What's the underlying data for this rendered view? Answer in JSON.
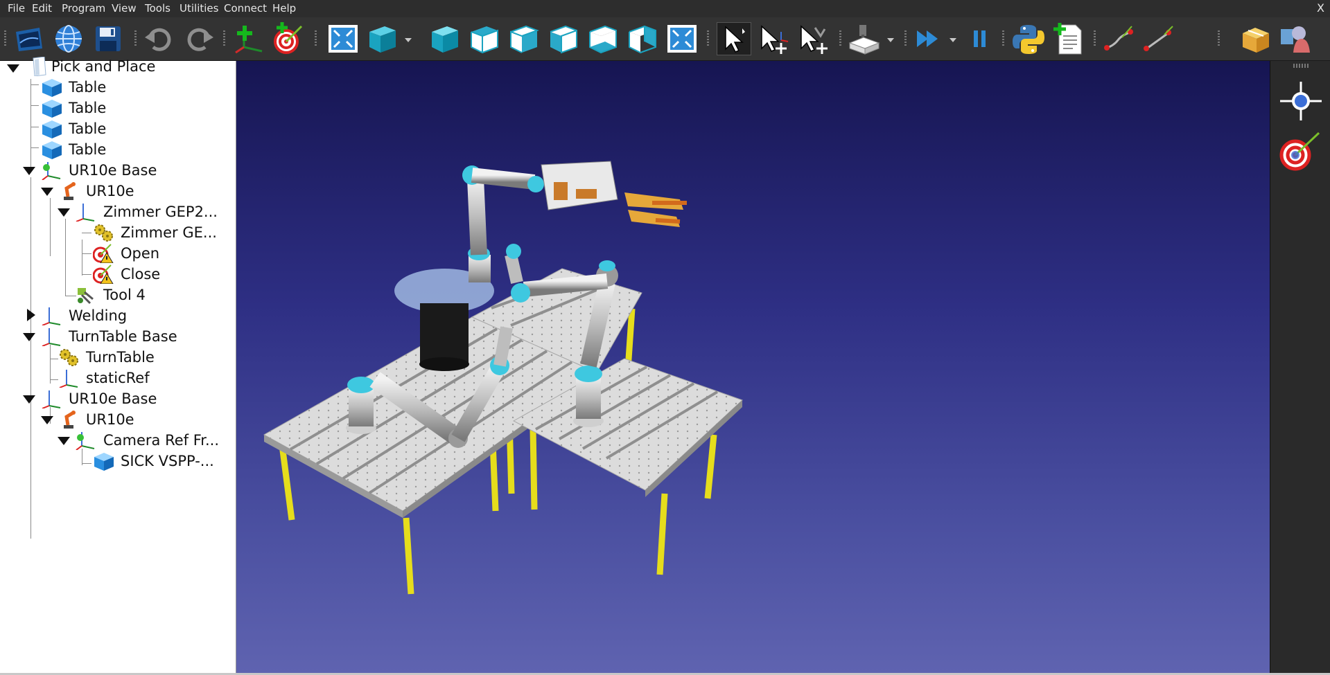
{
  "menubar": {
    "items": [
      "File",
      "Edit",
      "Program",
      "View",
      "Tools",
      "Utilities",
      "Connect",
      "Help"
    ],
    "close_label": "X"
  },
  "toolbar": {
    "buttons": [
      {
        "name": "open-station-icon",
        "active": false
      },
      {
        "name": "open-online-library-icon",
        "active": false
      },
      {
        "name": "save-icon",
        "active": false
      },
      {
        "name": "undo-icon",
        "active": false
      },
      {
        "name": "redo-icon",
        "active": false
      },
      {
        "name": "add-reference-frame-icon",
        "active": false
      },
      {
        "name": "add-target-icon",
        "active": false
      },
      {
        "name": "fit-all-icon",
        "active": false
      },
      {
        "name": "view-iso-icon",
        "active": false
      },
      {
        "name": "view-front-icon",
        "active": false
      },
      {
        "name": "view-top-icon",
        "active": false
      },
      {
        "name": "view-right-icon",
        "active": false
      },
      {
        "name": "view-left-icon",
        "active": false
      },
      {
        "name": "view-back-icon",
        "active": false
      },
      {
        "name": "view-bottom-icon",
        "active": false
      },
      {
        "name": "fit-selection-icon",
        "active": false
      },
      {
        "name": "select-pointer-icon",
        "active": true
      },
      {
        "name": "move-reference-icon",
        "active": false
      },
      {
        "name": "move-tool-icon",
        "active": false
      },
      {
        "name": "collision-check-icon",
        "active": false
      },
      {
        "name": "fast-simulation-icon",
        "active": false
      },
      {
        "name": "pause-icon",
        "active": false
      },
      {
        "name": "python-script-icon",
        "active": false
      },
      {
        "name": "add-program-icon",
        "active": false
      },
      {
        "name": "add-move-joint-icon",
        "active": false
      },
      {
        "name": "add-move-linear-icon",
        "active": false
      },
      {
        "name": "add-object-icon",
        "active": false
      },
      {
        "name": "3d-shapes-icon",
        "active": false
      }
    ]
  },
  "tree": {
    "items": [
      {
        "label": "Pick and Place",
        "icon": "station-icon",
        "expander": "open"
      },
      {
        "label": "Table",
        "icon": "object-icon",
        "expander": "none"
      },
      {
        "label": "Table",
        "icon": "object-icon",
        "expander": "none"
      },
      {
        "label": "Table",
        "icon": "object-icon",
        "expander": "none"
      },
      {
        "label": "Table",
        "icon": "object-icon",
        "expander": "none"
      },
      {
        "label": "UR10e Base",
        "icon": "base-frame-icon",
        "expander": "open"
      },
      {
        "label": "UR10e",
        "icon": "robot-icon",
        "expander": "open"
      },
      {
        "label": "Zimmer GEP2...",
        "icon": "reference-frame-icon",
        "expander": "open"
      },
      {
        "label": "Zimmer GE...",
        "icon": "mechanism-icon",
        "expander": "none"
      },
      {
        "label": "Open",
        "icon": "target-warning-icon",
        "expander": "none"
      },
      {
        "label": "Close",
        "icon": "target-warning-icon",
        "expander": "none"
      },
      {
        "label": "Tool 4",
        "icon": "tool-icon",
        "expander": "none"
      },
      {
        "label": "Welding",
        "icon": "reference-frame-icon",
        "expander": "closed"
      },
      {
        "label": "TurnTable Base",
        "icon": "reference-frame-icon",
        "expander": "open"
      },
      {
        "label": "TurnTable",
        "icon": "mechanism-icon",
        "expander": "none"
      },
      {
        "label": "staticRef",
        "icon": "reference-frame-icon",
        "expander": "none"
      },
      {
        "label": "UR10e Base",
        "icon": "reference-frame-icon",
        "expander": "open"
      },
      {
        "label": "UR10e",
        "icon": "robot-icon",
        "expander": "open"
      },
      {
        "label": "Camera Ref Fr...",
        "icon": "base-frame-icon",
        "expander": "open"
      },
      {
        "label": "SICK VSPP-...",
        "icon": "object-icon",
        "expander": "none"
      }
    ]
  },
  "sidepanel": {
    "tools": [
      {
        "name": "reference-frame-crosshair-icon"
      },
      {
        "name": "target-icon"
      }
    ]
  },
  "colors": {
    "viewport_top": "#161552",
    "viewport_bottom": "#5f63b0",
    "table_leg": "#e6dd1c",
    "table_top": "#d9d9d9",
    "robot_joint_accent": "#3ec8e0"
  }
}
